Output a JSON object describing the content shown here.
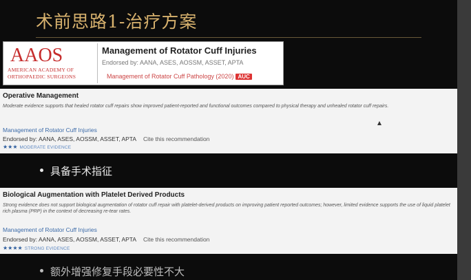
{
  "slide": {
    "title": "术前思路1-治疗方案"
  },
  "aaos_header": {
    "logo_mark": "AAOS",
    "logo_line1": "AMERICAN ACADEMY OF",
    "logo_line2": "ORTHOPAEDIC SURGEONS",
    "title": "Management of Rotator Cuff Injuries",
    "endorsed": "Endorsed by: AANA, ASES, AOSSM, ASSET, APTA",
    "link": "Management of Rotator Cuff Pathology (2020)",
    "badge": "AUC"
  },
  "cards": [
    {
      "title": "Operative Management",
      "description": "Moderate evidence supports that healed rotator cuff repairs show improved patient-reported and functional outcomes compared to physical therapy and unhealed rotator cuff repairs.",
      "link": "Management of Rotator Cuff Injuries",
      "endorsed": "Endorsed by: AANA, ASES, AOSSM, ASSET, APTA",
      "cite": "Cite this recommendation",
      "stars": "★★★",
      "evidence": "MODERATE EVIDENCE"
    },
    {
      "title": "Biological Augmentation with Platelet Derived Products",
      "description": "Strong evidence does not support biological augmentation of rotator cuff repair with platelet-derived products on improving patient reported outcomes; however, limited evidence supports the use of liquid platelet rich plasma (PRP) in the context of decreasing re-tear rates.",
      "link": "Management of Rotator Cuff Injuries",
      "endorsed": "Endorsed by: AANA, ASES, AOSSM, ASSET, APTA",
      "cite": "Cite this recommendation",
      "stars": "★★★★",
      "evidence": "STRONG EVIDENCE"
    }
  ],
  "bullets": [
    "具备手术指征",
    "额外增强修复手段必要性不大"
  ]
}
